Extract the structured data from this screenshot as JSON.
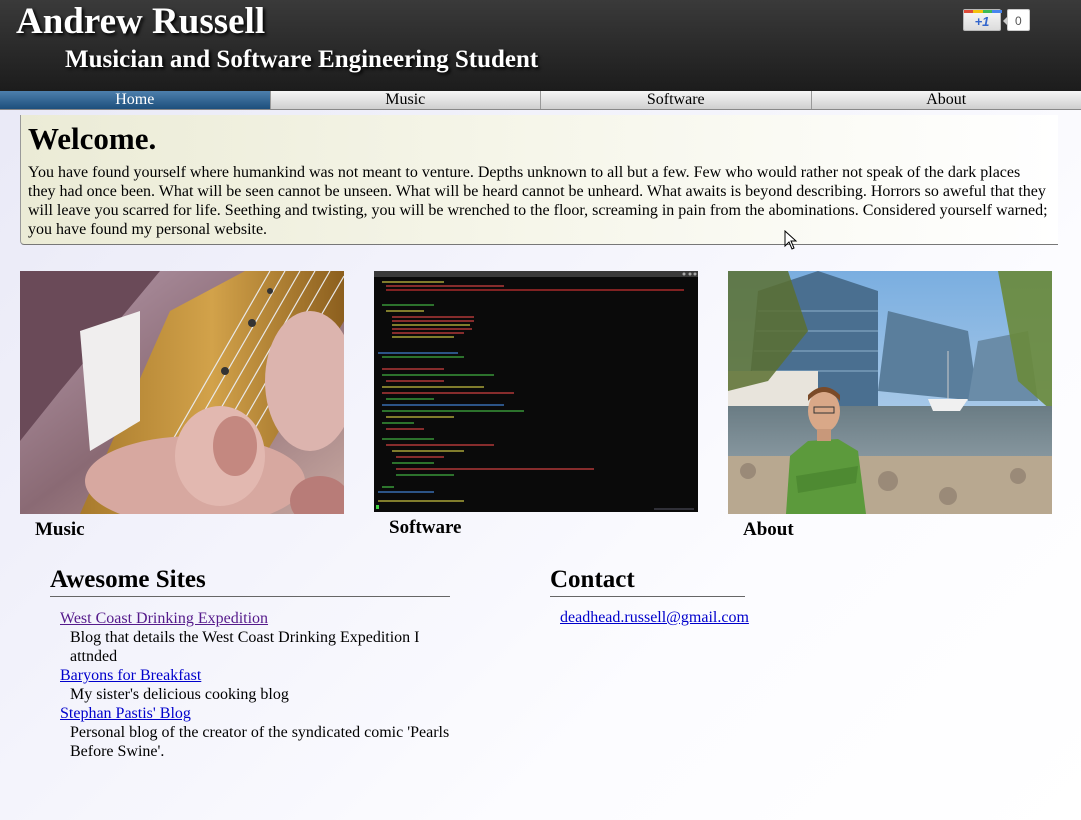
{
  "header": {
    "title": "Andrew Russell",
    "subtitle": "Musician and Software Engineering Student",
    "plusone": {
      "label": "+1",
      "count": "0"
    }
  },
  "nav": {
    "items": [
      {
        "label": "Home",
        "active": true
      },
      {
        "label": "Music",
        "active": false
      },
      {
        "label": "Software",
        "active": false
      },
      {
        "label": "About",
        "active": false
      }
    ]
  },
  "welcome": {
    "title": "Welcome.",
    "text": "You have found yourself where humankind was not meant to venture. Depths unknown to all but a few. Few who would rather not speak of the dark places they had once been. What will be seen cannot be unseen. What will be heard cannot be unheard. What awaits is beyond describing. Horrors so aweful that they will leave you scarred for life. Seething and twisting, you will be wrenched to the floor, screaming in pain from the abominations. Considered yourself warned; you have found my personal website."
  },
  "features": [
    {
      "label": "Music"
    },
    {
      "label": "Software"
    },
    {
      "label": "About"
    }
  ],
  "sites": {
    "title": "Awesome Sites",
    "items": [
      {
        "name": "West Coast Drinking Expedition",
        "desc": "Blog that details the West Coast Drinking Expedition I attnded",
        "visited": true
      },
      {
        "name": "Baryons for Breakfast",
        "desc": "My sister's delicious cooking blog",
        "visited": false
      },
      {
        "name": "Stephan Pastis' Blog",
        "desc": "Personal blog of the creator of the syndicated comic 'Pearls Before Swine'.",
        "visited": false
      }
    ]
  },
  "contact": {
    "title": "Contact",
    "email": "deadhead.russell@gmail.com"
  },
  "colors": {
    "nav_active": "#1d4f7c",
    "link": "#0000cc",
    "link_visited": "#551a8b",
    "header_bg": "#1c1c1c"
  }
}
